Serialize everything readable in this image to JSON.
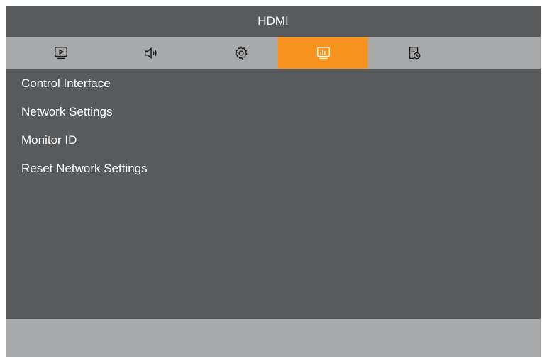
{
  "window": {
    "title": "HDMI"
  },
  "tabs": [
    {
      "id": "picture",
      "icon": "play-screen-icon",
      "active": false
    },
    {
      "id": "audio",
      "icon": "speaker-icon",
      "active": false
    },
    {
      "id": "settings",
      "icon": "gear-icon",
      "active": false
    },
    {
      "id": "network",
      "icon": "monitor-chart-icon",
      "active": true
    },
    {
      "id": "schedule",
      "icon": "document-clock-icon",
      "active": false
    }
  ],
  "menu": {
    "items": [
      {
        "label": "Control Interface"
      },
      {
        "label": "Network Settings"
      },
      {
        "label": "Monitor ID"
      },
      {
        "label": "Reset Network Settings"
      }
    ]
  },
  "colors": {
    "accent": "#f7941d",
    "panel": "#595a5c",
    "tab_bar": "#a8a9ab",
    "text": "#ffffff",
    "icon": "#1a1a1a"
  }
}
